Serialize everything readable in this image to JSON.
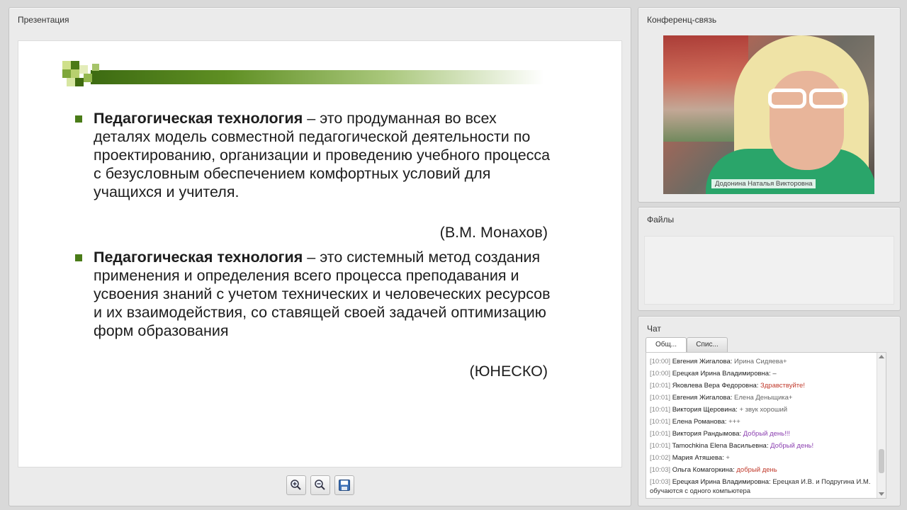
{
  "presentation": {
    "title": "Презентация",
    "slide": {
      "bullets": [
        {
          "term": "Педагогическая технология",
          "text": " – это продуманная во всех деталях модель совместной педагогической деятельности по проектированию, организации и проведению учебного процесса с безусловным обеспечением комфортных условий для учащихся и учителя.",
          "attribution": "(В.М. Монахов)"
        },
        {
          "term": "Педагогическая технология",
          "text": " – это системный метод создания применения и определения всего процесса преподавания и усвоения знаний с учетом технических и человеческих ресурсов и их взаимодействия, со ставящей своей задачей оптимизацию форм образования",
          "attribution": "(ЮНЕСКО)"
        }
      ]
    },
    "toolbar": [
      "zoom-in-icon",
      "zoom-out-icon",
      "save-icon"
    ]
  },
  "conference": {
    "title": "Конференц-связь",
    "speaker_name": "Додонина Наталья Викторовна"
  },
  "files": {
    "title": "Файлы"
  },
  "chat": {
    "title": "Чат",
    "tabs": [
      "Общ...",
      "Спис..."
    ],
    "messages": [
      {
        "time": "[10:00]",
        "name": "Евгения Жигалова:",
        "text": "Ирина Сидяева+",
        "color": "#666666"
      },
      {
        "time": "[10:00]",
        "name": "Ерецкая Ирина Владимировна:",
        "text": "–",
        "color": "#333333"
      },
      {
        "time": "[10:01]",
        "name": "Яковлева Вера Федоровна:",
        "text": "Здравствуйте!",
        "color": "#c0392b"
      },
      {
        "time": "[10:01]",
        "name": "Евгения Жигалова:",
        "text": "Елена Деныщика+",
        "color": "#666666"
      },
      {
        "time": "[10:01]",
        "name": "Виктория Щеровина:",
        "text": "+ звук хороший",
        "color": "#666666"
      },
      {
        "time": "[10:01]",
        "name": "Елена Романова:",
        "text": "+++",
        "color": "#666666"
      },
      {
        "time": "[10:01]",
        "name": "Виктория Рандымова:",
        "text": "Добрый день!!!",
        "color": "#8b3fb0"
      },
      {
        "time": "[10:01]",
        "name": "Tamochkina Elena Васильевна:",
        "text": "Добрый день!",
        "color": "#8b3fb0"
      },
      {
        "time": "[10:02]",
        "name": "Мария Атяшева:",
        "text": "+",
        "color": "#666666"
      },
      {
        "time": "[10:03]",
        "name": "Ольга Комагоркина:",
        "text": "добрый день",
        "color": "#c0392b"
      },
      {
        "time": "[10:03]",
        "name": "Ерецкая Ирина Владимировна:",
        "text": "Ерецкая И.В. и Подругина И.М. обучаются с одного компьютера",
        "color": "#333333"
      }
    ]
  }
}
